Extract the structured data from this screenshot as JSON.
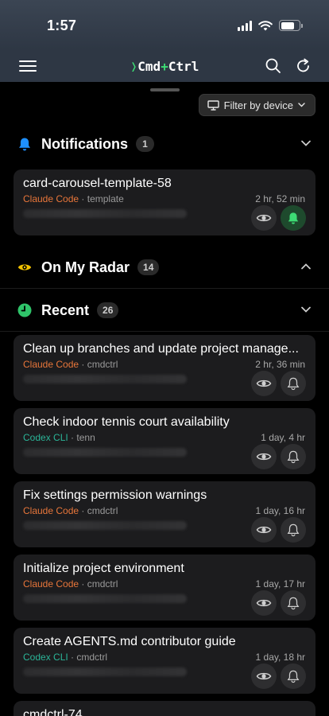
{
  "status_bar": {
    "time": "1:57"
  },
  "header": {
    "logo_prefix": "❭",
    "logo_left": "Cmd",
    "logo_plus": "+",
    "logo_right": "Ctrl"
  },
  "filter": {
    "label": "Filter by device"
  },
  "sections": {
    "notifications": {
      "title": "Notifications",
      "count": "1"
    },
    "radar": {
      "title": "On My Radar",
      "count": "14"
    },
    "recent": {
      "title": "Recent",
      "count": "26"
    }
  },
  "notification_cards": [
    {
      "title": "card-carousel-template-58",
      "agent": "Claude Code",
      "sep": "·",
      "project": "template",
      "time": "2 hr, 52 min",
      "bell_active": true
    }
  ],
  "recent_cards": [
    {
      "title": "Clean up branches and update project manage...",
      "agent": "Claude Code",
      "sep": "·",
      "project": "cmdctrl",
      "time": "2 hr, 36 min"
    },
    {
      "title": "Check indoor tennis court availability",
      "agent": "Codex CLI",
      "sep": "·",
      "project": "tenn",
      "time": "1 day, 4 hr"
    },
    {
      "title": "Fix settings permission warnings",
      "agent": "Claude Code",
      "sep": "·",
      "project": "cmdctrl",
      "time": "1 day, 16 hr"
    },
    {
      "title": "Initialize project environment",
      "agent": "Claude Code",
      "sep": "·",
      "project": "cmdctrl",
      "time": "1 day, 17 hr"
    },
    {
      "title": "Create AGENTS.md contributor guide",
      "agent": "Codex CLI",
      "sep": "·",
      "project": "cmdctrl",
      "time": "1 day, 18 hr"
    },
    {
      "title": "cmdctrl-74",
      "agent": "",
      "sep": "",
      "project": "",
      "time": ""
    }
  ],
  "colors": {
    "claude": "#e8763a",
    "codex": "#2bb598",
    "brand_green": "#3ddc74",
    "bell_blue": "#1e90ff",
    "eye_yellow": "#f2c200"
  }
}
